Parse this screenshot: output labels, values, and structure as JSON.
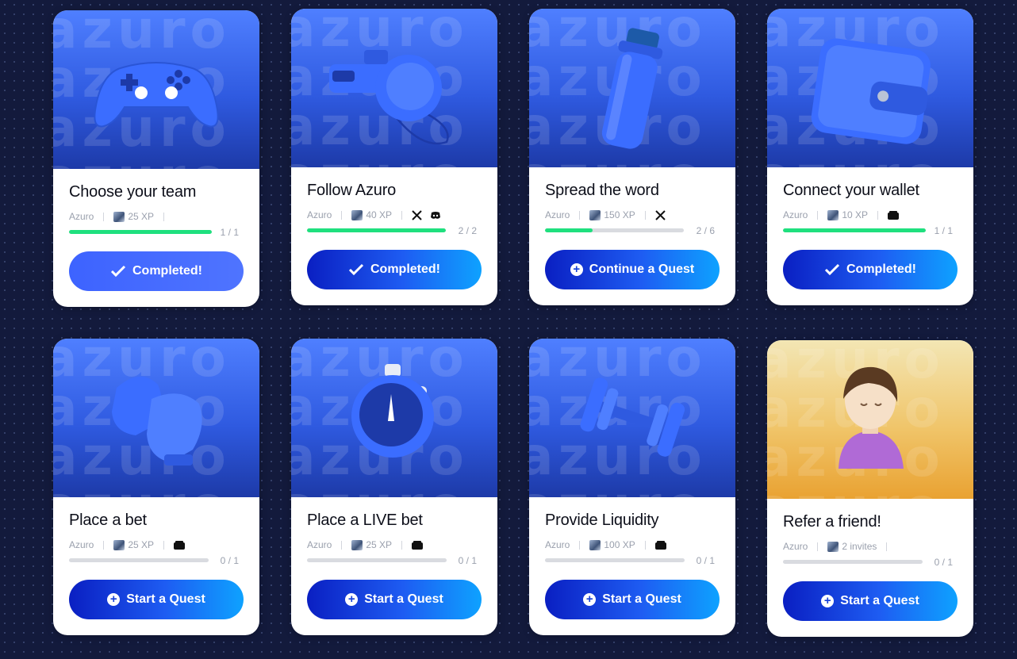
{
  "quests": [
    {
      "title": "Choose your team",
      "source": "Azuro",
      "reward": "25 XP",
      "icons": [],
      "progress": 1.0,
      "count": "1 / 1",
      "button": "Completed!",
      "state": "completed-light",
      "art": "gamepad-art"
    },
    {
      "title": "Follow Azuro",
      "source": "Azuro",
      "reward": "40 XP",
      "icons": [
        "x-icon",
        "discord-icon"
      ],
      "progress": 1.0,
      "count": "2 / 2",
      "button": "Completed!",
      "state": "completed",
      "art": "whistle-art"
    },
    {
      "title": "Spread the word",
      "source": "Azuro",
      "reward": "150 XP",
      "icons": [
        "x-icon"
      ],
      "progress": 0.34,
      "count": "2 / 6",
      "button": "Continue a Quest",
      "state": "continue",
      "art": "bottle-art"
    },
    {
      "title": "Connect your wallet",
      "source": "Azuro",
      "reward": "10 XP",
      "icons": [
        "wallet-icon"
      ],
      "progress": 1.0,
      "count": "1 / 1",
      "button": "Completed!",
      "state": "completed",
      "art": "wallet-art"
    },
    {
      "title": "Place a bet",
      "source": "Azuro",
      "reward": "25 XP",
      "icons": [
        "wallet-icon"
      ],
      "progress": 0,
      "count": "0 / 1",
      "button": "Start a Quest",
      "state": "start",
      "art": "boxing-gloves-art"
    },
    {
      "title": "Place a LIVE bet",
      "source": "Azuro",
      "reward": "25 XP",
      "icons": [
        "wallet-icon"
      ],
      "progress": 0,
      "count": "0 / 1",
      "button": "Start a Quest",
      "state": "start",
      "art": "stopwatch-art"
    },
    {
      "title": "Provide Liquidity",
      "source": "Azuro",
      "reward": "100 XP",
      "icons": [
        "wallet-icon"
      ],
      "progress": 0,
      "count": "0 / 1",
      "button": "Start a Quest",
      "state": "start",
      "art": "dumbbell-art"
    },
    {
      "title": "Refer a friend!",
      "source": "Azuro",
      "reward": "2 invites",
      "icons": [],
      "progress": 0,
      "count": "0 / 1",
      "button": "Start a Quest",
      "state": "start",
      "art": "avatar-art"
    }
  ],
  "colors": {
    "progress_fill": "#1fe07e",
    "button_start": "#0a1fc2",
    "button_end": "#0ea2ff",
    "background": "#131a3c"
  }
}
